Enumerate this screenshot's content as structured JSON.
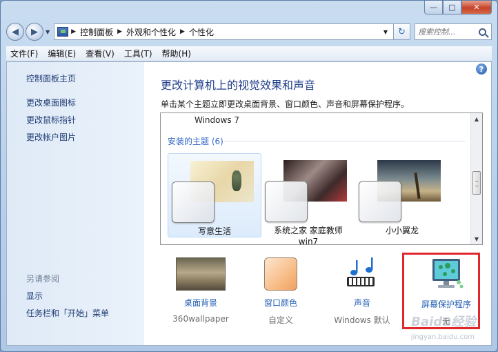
{
  "window": {
    "caption_minimize": "—",
    "caption_maximize": "□",
    "caption_close": "✕"
  },
  "address_bar": {
    "breadcrumbs": [
      "控制面板",
      "外观和个性化",
      "个性化"
    ],
    "search_placeholder": "搜索控制..."
  },
  "menu": {
    "items": [
      "文件(F)",
      "编辑(E)",
      "查看(V)",
      "工具(T)",
      "帮助(H)"
    ]
  },
  "sidebar": {
    "home": "控制面板主页",
    "links": [
      "更改桌面图标",
      "更改鼠标指针",
      "更改帐户图片"
    ],
    "see_also_heading": "另请参阅",
    "see_also_links": [
      "显示",
      "任务栏和「开始」菜单"
    ]
  },
  "main": {
    "help": "?",
    "title": "更改计算机上的视觉效果和声音",
    "subtitle": "单击某个主题立即更改桌面背景、窗口颜色、声音和屏幕保护程序。",
    "windows7_label": "Windows 7",
    "installed_label": "安装的主题 (6)",
    "themes": [
      {
        "name": "写意生活",
        "selected": true
      },
      {
        "name": "系统之家 家庭教师\nwin7",
        "selected": false
      },
      {
        "name": "小小翼龙",
        "selected": false
      }
    ]
  },
  "options": [
    {
      "label": "桌面背景",
      "value": "360wallpaper"
    },
    {
      "label": "窗口颜色",
      "value": "自定义"
    },
    {
      "label": "声音",
      "value": "Windows 默认"
    },
    {
      "label": "屏幕保护程序",
      "value": "无"
    }
  ],
  "watermark": {
    "text": "Baidu经验",
    "sub": "jingyan.baidu.com"
  },
  "colors": {
    "title_blue": "#1e3c88",
    "link_blue": "#1e5cb3",
    "highlight_red": "#e0272b"
  }
}
